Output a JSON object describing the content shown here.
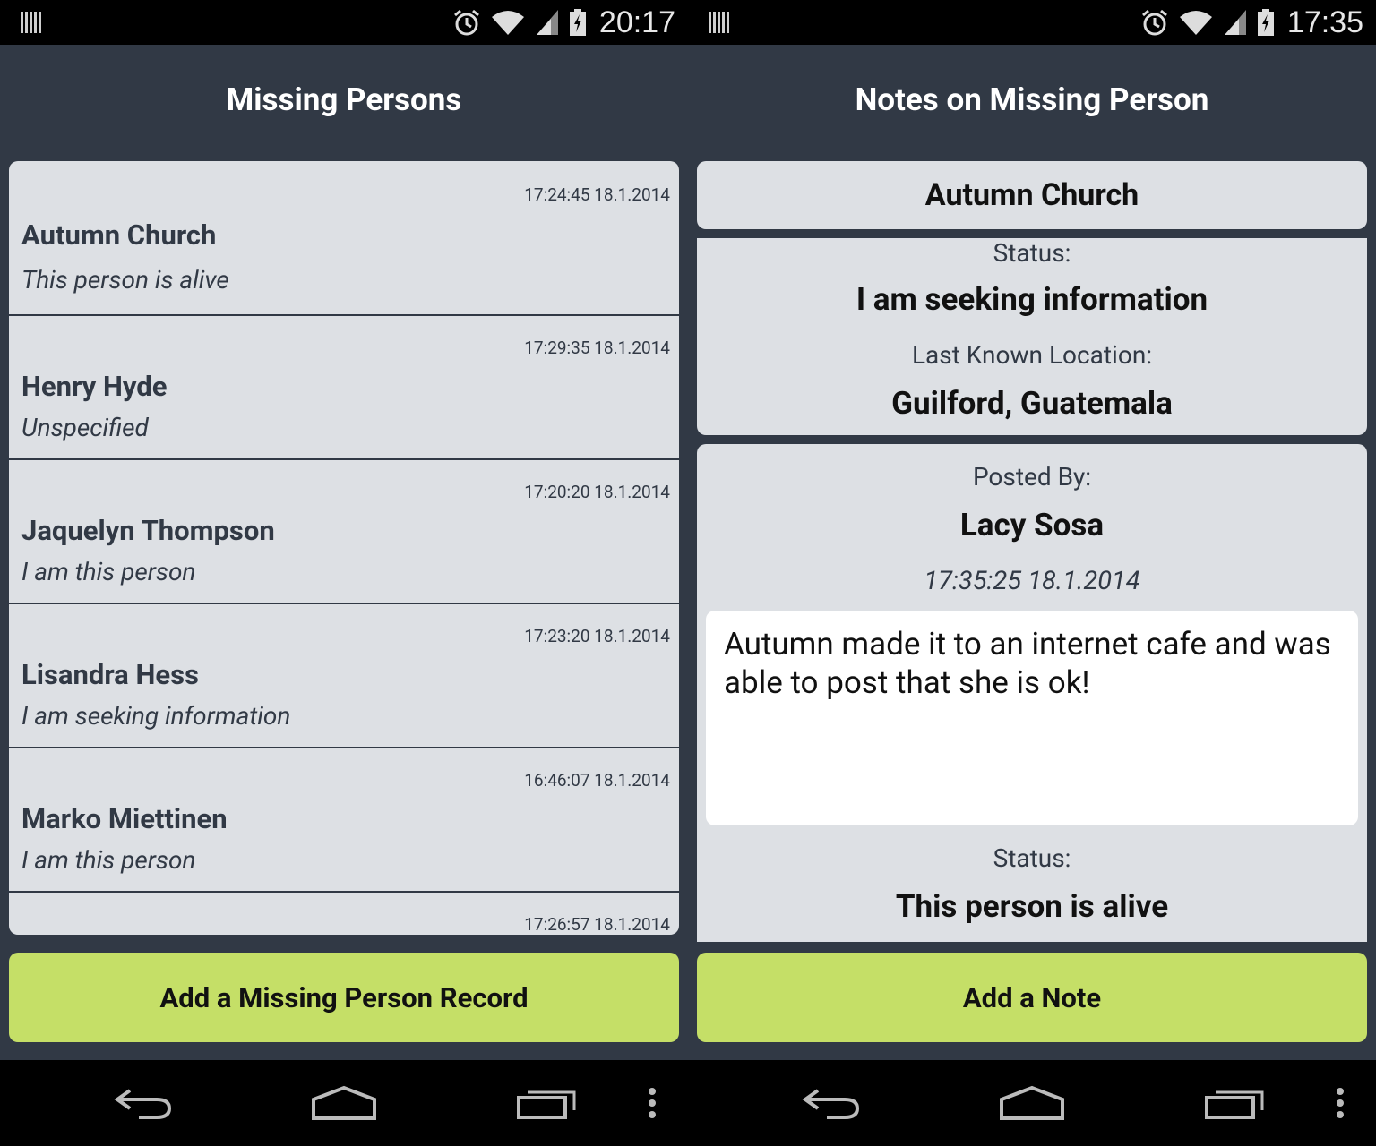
{
  "left_screen": {
    "status_bar": {
      "time": "20:17",
      "icons": [
        "notification-icon",
        "alarm-icon",
        "wifi-icon",
        "signal-icon",
        "battery-charging-icon"
      ]
    },
    "title": "Missing Persons",
    "records": [
      {
        "timestamp": "17:24:45 18.1.2014",
        "name": "Autumn Church",
        "status": "This person is alive"
      },
      {
        "timestamp": "17:29:35 18.1.2014",
        "name": "Henry Hyde",
        "status": "Unspecified"
      },
      {
        "timestamp": "17:20:20 18.1.2014",
        "name": "Jaquelyn Thompson",
        "status": "I am this person"
      },
      {
        "timestamp": "17:23:20 18.1.2014",
        "name": "Lisandra Hess",
        "status": "I am seeking information"
      },
      {
        "timestamp": "16:46:07 18.1.2014",
        "name": "Marko Miettinen",
        "status": "I am this person"
      },
      {
        "timestamp": "17:26:57 18.1.2014",
        "name": "",
        "status": ""
      }
    ],
    "add_button_label": "Add a Missing Person Record"
  },
  "right_screen": {
    "status_bar": {
      "time": "17:35",
      "icons": [
        "notification-icon",
        "alarm-icon",
        "wifi-icon",
        "signal-icon",
        "battery-charging-icon"
      ]
    },
    "title": "Notes on Missing Person",
    "person_name": "Autumn Church",
    "status_label": "Status:",
    "status_value": "I am seeking information",
    "location_label": "Last Known Location:",
    "location_value": "Guilford, Guatemala",
    "note": {
      "posted_by_label": "Posted By:",
      "posted_by": "Lacy Sosa",
      "timestamp": "17:35:25 18.1.2014",
      "text": "Autumn made it to an internet cafe and was able to post that she is ok!",
      "status_label": "Status:",
      "status_value": "This person is alive"
    },
    "add_button_label": "Add a Note"
  },
  "nav_bar": {
    "icons": [
      "back-icon",
      "home-icon",
      "recent-apps-icon",
      "menu-icon"
    ]
  },
  "colors": {
    "background": "#313945",
    "card": "#dde0e4",
    "accent_button": "#c5df67"
  }
}
